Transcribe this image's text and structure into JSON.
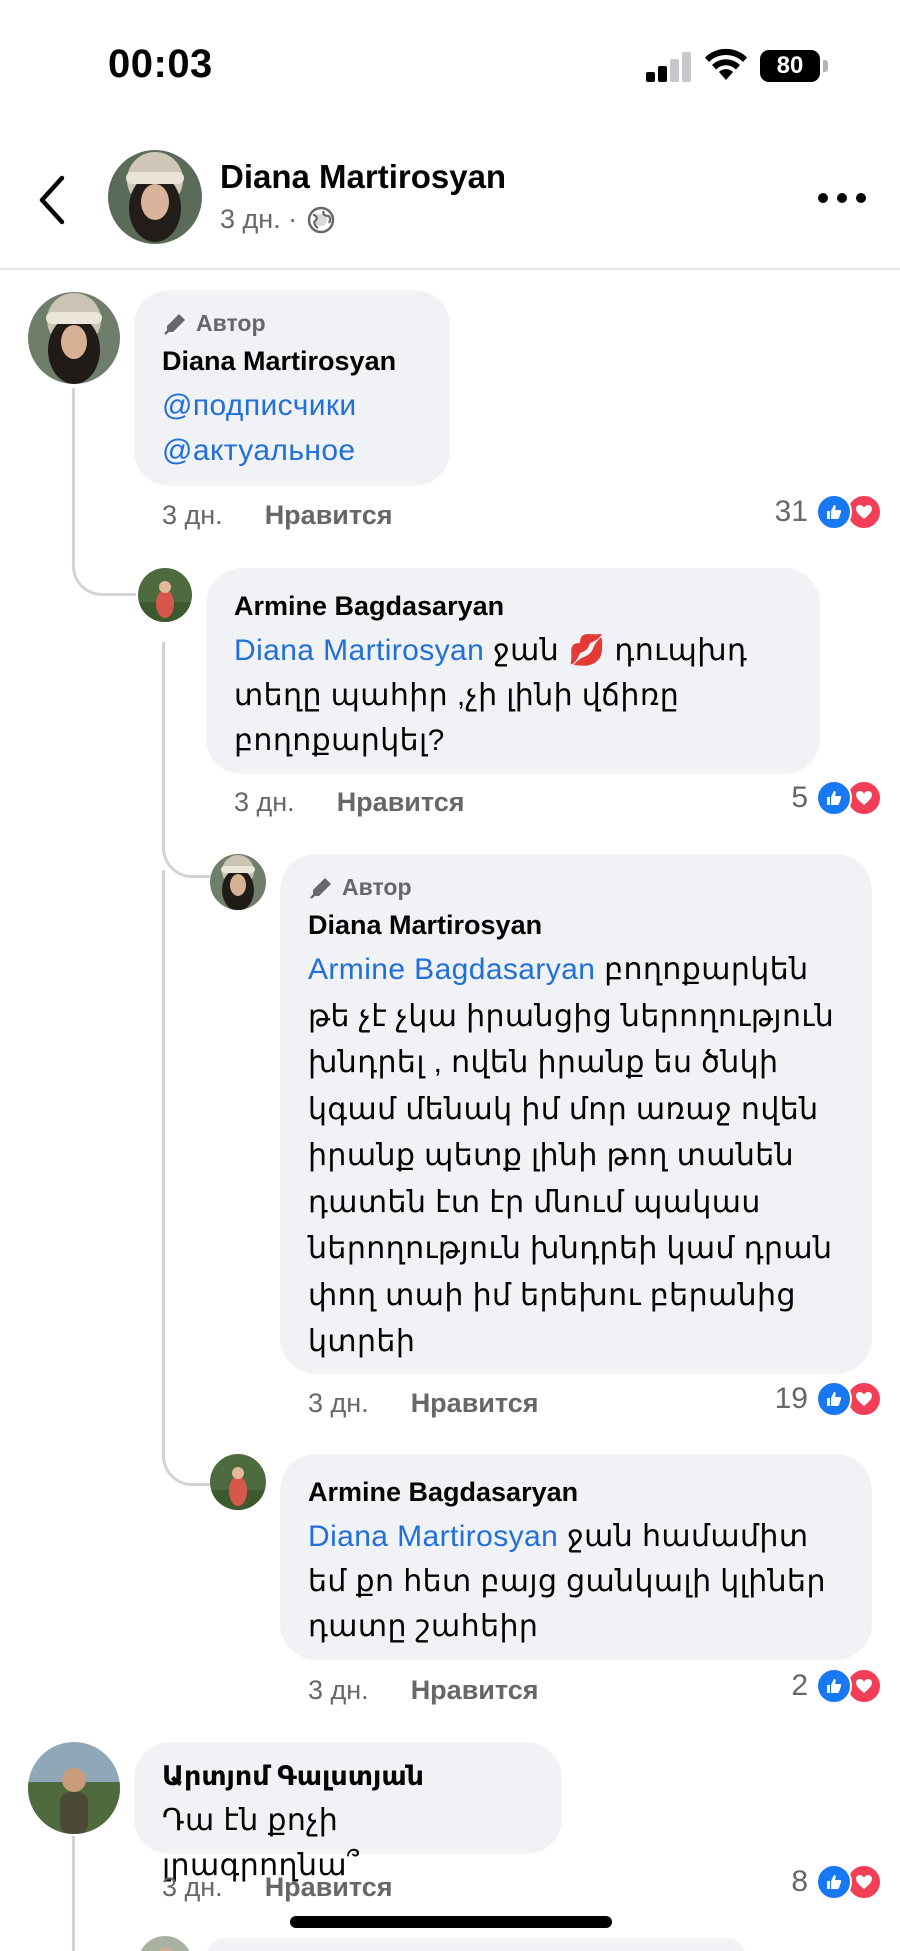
{
  "status": {
    "time": "00:03",
    "battery": "80"
  },
  "header": {
    "name": "Diana Martirosyan",
    "meta": "3 дн. ·"
  },
  "comments": [
    {
      "author_badge": "Автор",
      "name": "Diana Martirosyan",
      "mention1": "@подписчики",
      "mention2": "@актуальное",
      "time": "3 дн.",
      "like": "Нравится",
      "count": "31"
    },
    {
      "name": "Armine Bagdasaryan",
      "mention": "Diana Martirosyan",
      "text": " ջան 💋  դուպխդ տեղը պահիր ,չի լինի վճիռը բողոքարկել?",
      "time": "3 дн.",
      "like": "Нравится",
      "count": "5"
    },
    {
      "author_badge": "Автор",
      "name": "Diana Martirosyan",
      "mention": "Armine Bagdasaryan",
      "text": " բողոքարկեն թե չէ չկա իրանցից ներողություն խնդրել , ովեն իրանք ես ծնկի կգամ մենակ իմ մոր առաջ ովեն իրանք պետք լինի  թող տանեն դատեն էտ էր մնում պակաս ներողություն խնդրեի կամ դրան փող տաի իմ երեխու բերանից կտրեի",
      "time": "3 дн.",
      "like": "Нравится",
      "count": "19"
    },
    {
      "name": "Armine Bagdasaryan",
      "mention": "Diana Martirosyan",
      "text": " ջան համամիտ եմ քո հետ բայց ցանկալի կլիներ դատը շահեիր",
      "time": "3 дн.",
      "like": "Нравится",
      "count": "2"
    },
    {
      "name": "Արտյոմ Գալստյան",
      "text": "Դա էն քոչի լրագրողնա՞",
      "time": "3 дн.",
      "like": "Нравится",
      "count": "8"
    }
  ]
}
